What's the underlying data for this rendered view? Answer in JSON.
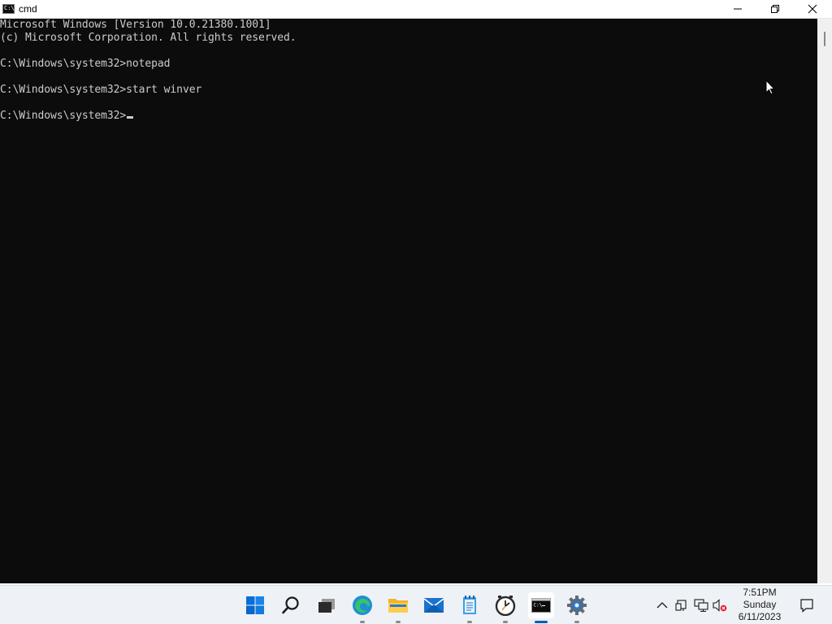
{
  "window": {
    "title": "cmd",
    "app_icon_glyph": "C:\\"
  },
  "console": {
    "lines": [
      "Microsoft Windows [Version 10.0.21380.1001]",
      "(c) Microsoft Corporation. All rights reserved.",
      "",
      "C:\\Windows\\system32>notepad",
      "",
      "C:\\Windows\\system32>start winver",
      "",
      "C:\\Windows\\system32>"
    ],
    "text_color": "#cccccc",
    "background": "#0c0c0c"
  },
  "taskbar": {
    "apps": [
      {
        "name": "start-button",
        "icon": "windows-logo-icon",
        "running": false
      },
      {
        "name": "search-button",
        "icon": "search-icon",
        "running": false
      },
      {
        "name": "task-view-button",
        "icon": "task-view-icon",
        "running": false
      },
      {
        "name": "edge-button",
        "icon": "edge-icon",
        "running": true
      },
      {
        "name": "file-explorer-button",
        "icon": "folder-icon",
        "running": true
      },
      {
        "name": "mail-button",
        "icon": "mail-icon",
        "running": false
      },
      {
        "name": "notepad-button",
        "icon": "notepad-icon",
        "running": true
      },
      {
        "name": "clock-app-button",
        "icon": "clock-icon",
        "running": true
      },
      {
        "name": "cmd-button",
        "icon": "cmd-icon",
        "running": true,
        "active": true
      },
      {
        "name": "settings-button",
        "icon": "gear-icon",
        "running": true
      }
    ],
    "accent": "#005fb8",
    "clock": {
      "time": "7:51PM",
      "day": "Sunday",
      "date": "6/11/2023"
    }
  }
}
